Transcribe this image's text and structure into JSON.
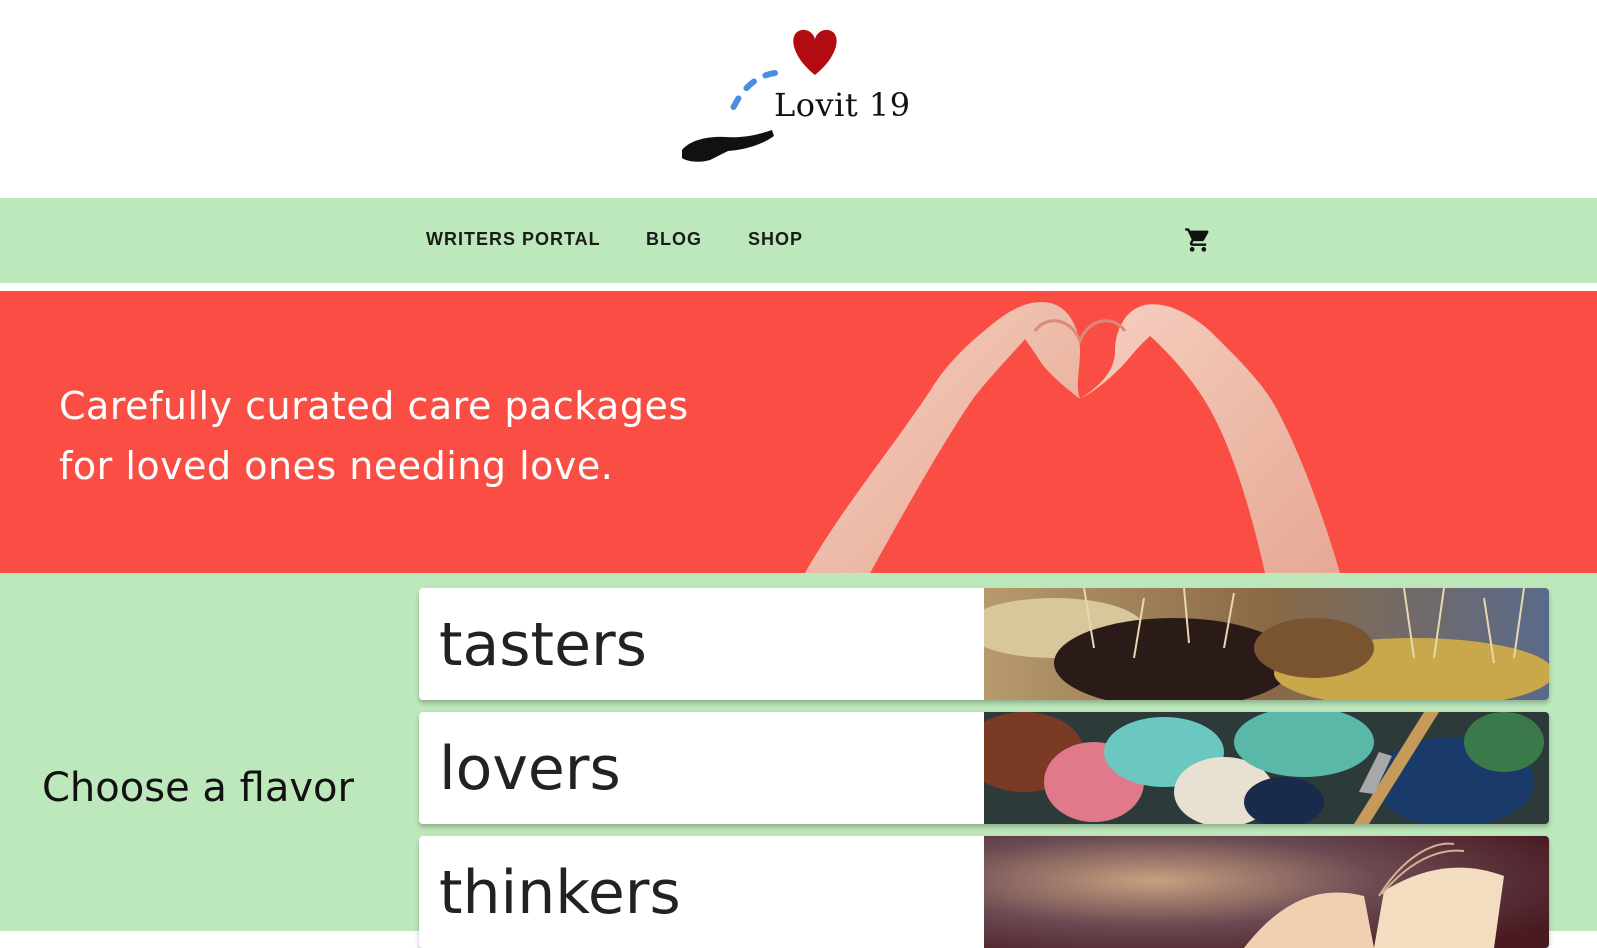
{
  "brand": {
    "name": "Lovit 19",
    "heart_color": "#b30b12",
    "path_color": "#4a8ee0"
  },
  "nav": {
    "items": [
      {
        "label": "WRITERS PORTAL"
      },
      {
        "label": "BLOG"
      },
      {
        "label": "SHOP"
      }
    ],
    "cart_icon": "shopping-cart-icon",
    "background": "#bde8bb"
  },
  "hero": {
    "line1": "Carefully curated care packages",
    "line2": "for loved ones needing love.",
    "background": "#fa4e44"
  },
  "flavors": {
    "label": "Choose a flavor",
    "items": [
      {
        "title": "tasters",
        "image": "olives-on-skewers"
      },
      {
        "title": "lovers",
        "image": "paint-palette-brushes"
      },
      {
        "title": "thinkers",
        "image": "open-book"
      }
    ]
  }
}
